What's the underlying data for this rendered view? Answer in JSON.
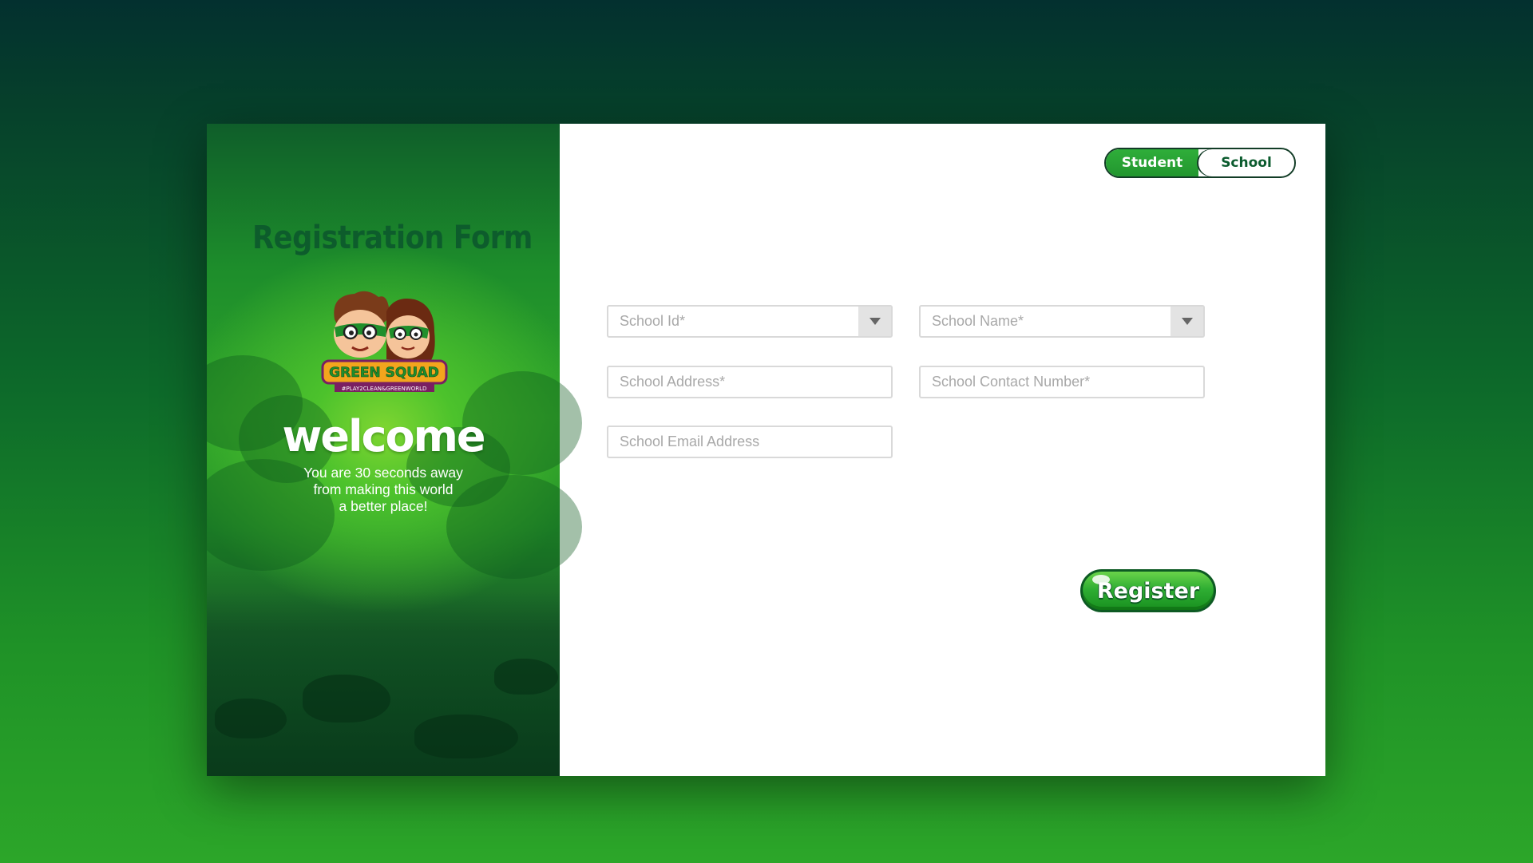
{
  "colors": {
    "brand_green": "#0d5c2c",
    "accent_green": "#2fae3a",
    "button_dark": "#0d5a23"
  },
  "left_panel": {
    "logo": {
      "name": "GREEN SQUAD",
      "tagline": "#PLAY2CLEAN&GREENWORLD",
      "icon": "green-squad-mascots-logo"
    },
    "welcome": "welcome",
    "subtitle_line1": "You are 30 seconds away",
    "subtitle_line2": "from making this world",
    "subtitle_line3": "a better place!"
  },
  "toggle": {
    "student_label": "Student",
    "school_label": "School",
    "selected": "School"
  },
  "form": {
    "title": "Registration Form",
    "fields": {
      "school_id": {
        "placeholder": "School Id*",
        "value": ""
      },
      "school_name": {
        "placeholder": "School Name*",
        "value": ""
      },
      "school_address": {
        "placeholder": "School Address*",
        "value": ""
      },
      "school_contact": {
        "placeholder": "School Contact Number*",
        "value": ""
      },
      "school_email": {
        "placeholder": "School Email Address",
        "value": ""
      }
    },
    "register_label": "Register"
  }
}
